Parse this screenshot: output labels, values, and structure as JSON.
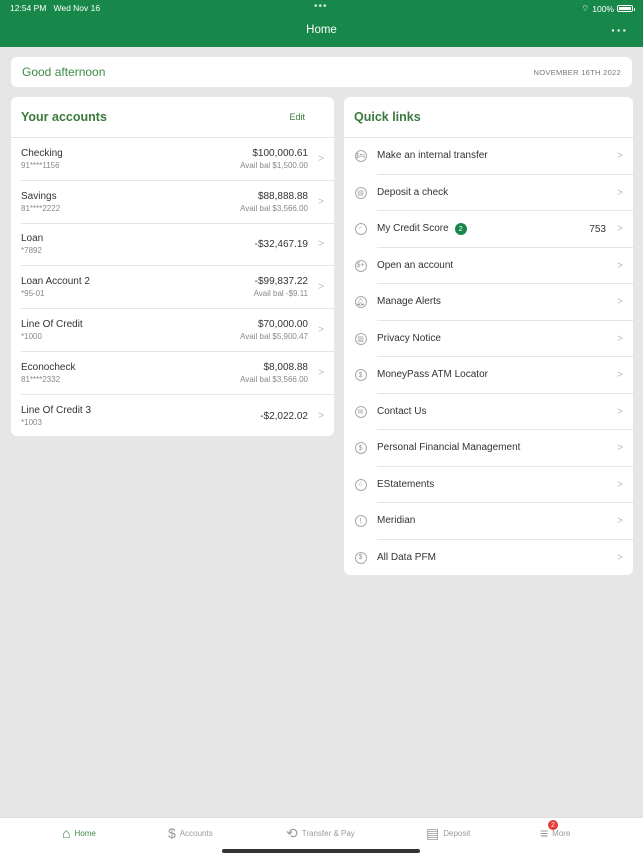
{
  "status_bar": {
    "time": "12:54 PM",
    "date": "Wed Nov 16",
    "battery": "100%"
  },
  "nav": {
    "title": "Home",
    "more_icon": "ellipsis-icon"
  },
  "greeting": {
    "text": "Good afternoon",
    "date": "NOVEMBER 16TH 2022"
  },
  "accounts": {
    "title": "Your accounts",
    "edit_label": "Edit",
    "items": [
      {
        "name": "Checking",
        "number": "91****1156",
        "balance": "$100,000.61",
        "avail": "Avail bal $1,500.00"
      },
      {
        "name": "Savings",
        "number": "81****2222",
        "balance": "$88,888.88",
        "avail": "Avail bal $3,566.00"
      },
      {
        "name": "Loan",
        "number": "*7892",
        "balance": "-$32,467.19",
        "avail": ""
      },
      {
        "name": "Loan Account 2",
        "number": "*95-01",
        "balance": "-$99,837.22",
        "avail": "Avail bal -$9.11"
      },
      {
        "name": "Line Of Credit",
        "number": "*1000",
        "balance": "$70,000.00",
        "avail": "Avail bal $5,900.47"
      },
      {
        "name": "Econocheck",
        "number": "81****2332",
        "balance": "$8,008.88",
        "avail": "Avail bal $3,566.00"
      },
      {
        "name": "Line Of Credit 3",
        "number": "*1003",
        "balance": "-$2,022.02",
        "avail": ""
      }
    ]
  },
  "quick_links": {
    "title": "Quick links",
    "items": [
      {
        "label": "Make an internal transfer",
        "icon": "transfer-icon",
        "glyph": "$⇆"
      },
      {
        "label": "Deposit a check",
        "icon": "check-deposit-icon",
        "glyph": "▤"
      },
      {
        "label": "My Credit Score",
        "icon": "gauge-icon",
        "glyph": "◜",
        "badge": "2",
        "value": "753"
      },
      {
        "label": "Open an account",
        "icon": "dollar-plus-icon",
        "glyph": "$+"
      },
      {
        "label": "Manage Alerts",
        "icon": "bell-icon",
        "glyph": "🔔︎"
      },
      {
        "label": "Privacy Notice",
        "icon": "privacy-icon",
        "glyph": "▥"
      },
      {
        "label": "MoneyPass ATM Locator",
        "icon": "dollar-circle-icon",
        "glyph": "$"
      },
      {
        "label": "Contact Us",
        "icon": "mail-icon",
        "glyph": "✉"
      },
      {
        "label": "Personal Financial Management",
        "icon": "dollar-circle-icon",
        "glyph": "$"
      },
      {
        "label": "EStatements",
        "icon": "bank-icon",
        "glyph": "⌂"
      },
      {
        "label": "Meridian",
        "icon": "info-circle-icon",
        "glyph": "!"
      },
      {
        "label": "All Data PFM",
        "icon": "dollar-circle-icon",
        "glyph": "$"
      }
    ]
  },
  "tabs": [
    {
      "label": "Home",
      "icon": "home-dollar-icon",
      "glyph": "⌂",
      "active": true
    },
    {
      "label": "Accounts",
      "icon": "dollar-icon",
      "glyph": "$"
    },
    {
      "label": "Transfer & Pay",
      "icon": "transfer-pay-icon",
      "glyph": "⟲"
    },
    {
      "label": "Deposit",
      "icon": "deposit-icon",
      "glyph": "▤"
    },
    {
      "label": "More",
      "icon": "menu-icon",
      "glyph": "≡",
      "badge": "2"
    }
  ],
  "colors": {
    "brand_green": "#17874a",
    "title_green": "#3b7a3e",
    "badge_red": "#e53935"
  }
}
